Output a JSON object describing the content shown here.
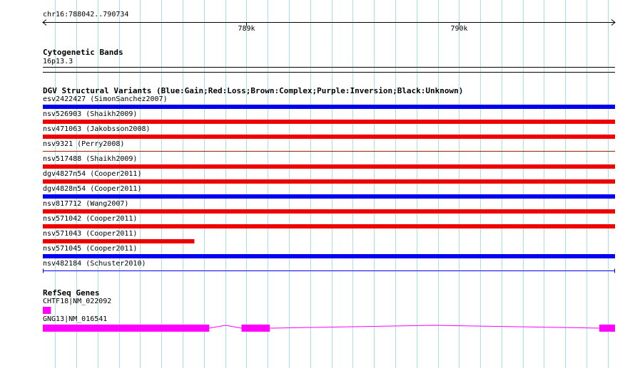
{
  "ruler": {
    "location": "chr16:788042..790734",
    "start": 788042,
    "end": 790734,
    "gridline_step_bp": 100,
    "ticks": [
      {
        "label": "789k",
        "pos": 789000
      },
      {
        "label": "790k",
        "pos": 790000
      }
    ]
  },
  "tracks": {
    "cytoband": {
      "title": "Cytogenetic Bands",
      "band": "16p13.3",
      "color": "#000000"
    },
    "dgv": {
      "title": "DGV Structural Variants (Blue:Gain;Red:Loss;Brown:Complex;Purple:Inversion;Black:Unknown)",
      "colors": {
        "Gain": "#0000ee",
        "Loss": "#ee0000",
        "Complex": "#8b2500",
        "Inversion": "#a020f0",
        "Unknown": "#000000"
      },
      "features": [
        {
          "label": "esv2422427 (SimonSanchez2007)",
          "type": "Gain",
          "start": 788042,
          "end": 790734,
          "style": "bar"
        },
        {
          "label": "nsv526903 (Shaikh2009)",
          "type": "Loss",
          "start": 788042,
          "end": 790734,
          "style": "bar"
        },
        {
          "label": "nsv471063 (Jakobsson2008)",
          "type": "Loss",
          "start": 788042,
          "end": 790734,
          "style": "bar"
        },
        {
          "label": "nsv9321 (Perry2008)",
          "type": "Complex",
          "start": 788042,
          "end": 790734,
          "style": "thin"
        },
        {
          "label": "nsv517488 (Shaikh2009)",
          "type": "Loss",
          "start": 788042,
          "end": 790734,
          "style": "bar"
        },
        {
          "label": "dgv4827n54 (Cooper2011)",
          "type": "Loss",
          "start": 788042,
          "end": 790734,
          "style": "bar"
        },
        {
          "label": "dgv4828n54 (Cooper2011)",
          "type": "Gain",
          "start": 788042,
          "end": 790734,
          "style": "bar"
        },
        {
          "label": "nsv817712 (Wang2007)",
          "type": "Loss",
          "start": 788042,
          "end": 790734,
          "style": "bar"
        },
        {
          "label": "nsv571042 (Cooper2011)",
          "type": "Loss",
          "start": 788042,
          "end": 790734,
          "style": "bar"
        },
        {
          "label": "nsv571043 (Cooper2011)",
          "type": "Loss",
          "start": 788042,
          "end": 788755,
          "style": "bar"
        },
        {
          "label": "nsv571045 (Cooper2011)",
          "type": "Gain",
          "start": 788042,
          "end": 790734,
          "style": "bar"
        },
        {
          "label": "nsv482184 (Schuster2010)",
          "type": "Gain",
          "start": 788042,
          "end": 790734,
          "style": "bracket"
        }
      ]
    },
    "refseq": {
      "title": "RefSeq Genes",
      "color": "#ff00ff",
      "genes": [
        {
          "label": "CHTF18|NM_022092",
          "start": 788042,
          "end": 790734,
          "exons": [
            {
              "start": 788042,
              "end": 788080
            }
          ]
        },
        {
          "label": "GNG13|NM_016541",
          "start": 788042,
          "end": 790734,
          "exons": [
            {
              "start": 788042,
              "end": 788825
            },
            {
              "start": 788977,
              "end": 789110
            },
            {
              "start": 790660,
              "end": 790734
            }
          ]
        }
      ]
    }
  }
}
